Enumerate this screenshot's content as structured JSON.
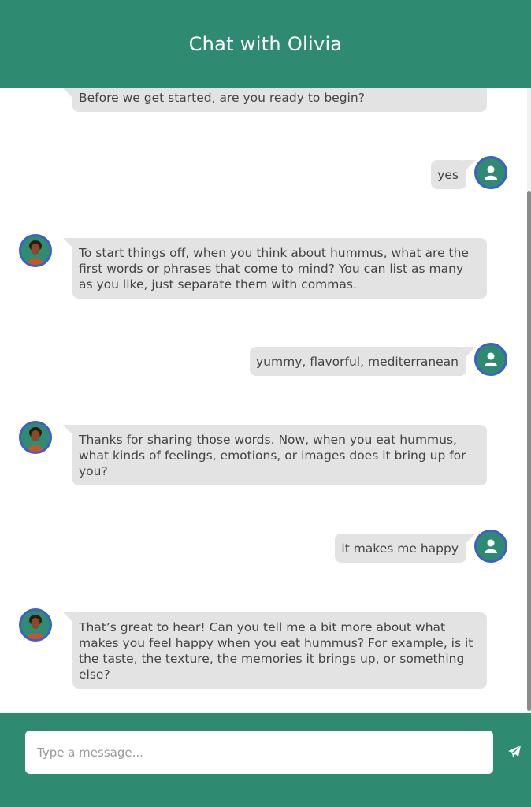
{
  "header": {
    "title": "Chat with Olivia"
  },
  "messages": [
    {
      "from": "bot",
      "text": "Before we get started, are you ready to begin?"
    },
    {
      "from": "user",
      "text": "yes"
    },
    {
      "from": "bot",
      "text": "To start things off, when you think about hummus, what are the first words or phrases that come to mind? You can list as many as you like, just separate them with commas."
    },
    {
      "from": "user",
      "text": "yummy, flavorful, mediterranean"
    },
    {
      "from": "bot",
      "text": "Thanks for sharing those words. Now, when you eat hummus, what kinds of feelings, emotions, or images does it bring up for you?"
    },
    {
      "from": "user",
      "text": "it makes me happy"
    },
    {
      "from": "bot",
      "text": "That’s great to hear! Can you tell me a bit more about what makes you feel happy when you eat hummus? For example, is it the taste, the texture, the memories it brings up, or something else?"
    }
  ],
  "composer": {
    "placeholder": "Type a message...",
    "value": ""
  },
  "icons": {
    "user_avatar": "user-icon",
    "bot_avatar": "person-photo",
    "send": "paper-plane-icon"
  },
  "colors": {
    "brand": "#2e8b72",
    "bubble": "#e3e3e3",
    "avatar_ring": "#3f5fc8"
  }
}
